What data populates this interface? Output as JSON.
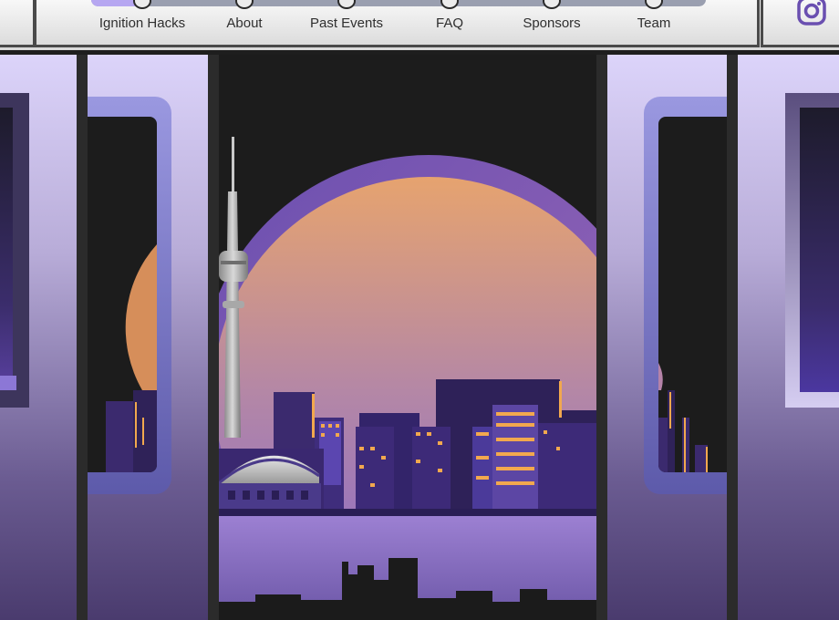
{
  "nav": {
    "links": [
      "Ignition Hacks",
      "About",
      "Past Events",
      "FAQ",
      "Sponsors",
      "Team"
    ],
    "active_index": 0
  },
  "icons": {
    "social": "instagram-icon",
    "hero_scene": "toronto-skyline-illustration"
  },
  "colors": {
    "accent": "#b6a7f1",
    "icon": "#6a4fb0",
    "moon_top": "#e6a36f",
    "moon_bottom": "#8a6ac8",
    "city": "#3d2a78",
    "lights": "#f2a84e",
    "water": "#9c80d2"
  }
}
